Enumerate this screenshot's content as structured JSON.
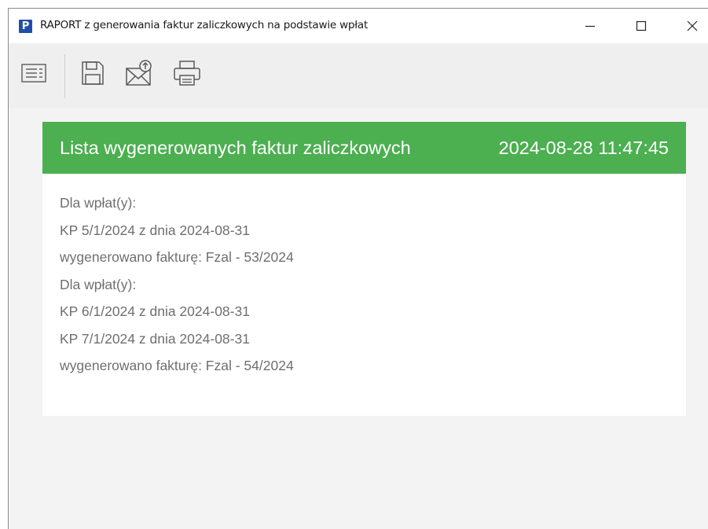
{
  "window": {
    "app_icon_letter": "P",
    "title": "RAPORT z generowania faktur zaliczkowych na podstawie wpłat",
    "controls": {
      "minimize": "minimize-icon",
      "maximize": "maximize-icon",
      "close": "close-icon"
    }
  },
  "toolbar": {
    "buttons": [
      {
        "icon": "list-icon"
      },
      {
        "icon": "save-icon"
      },
      {
        "icon": "send-mail-icon"
      },
      {
        "icon": "print-icon"
      }
    ]
  },
  "report": {
    "header_title": "Lista wygenerowanych faktur zaliczkowych",
    "header_datetime": "2024-08-28 11:47:45",
    "header_color": "#4caf50",
    "lines": [
      "Dla wpłat(y):",
      "KP 5/1/2024 z dnia 2024-08-31",
      "wygenerowano fakturę: Fzal - 53/2024",
      "Dla wpłat(y):",
      "KP 6/1/2024 z dnia 2024-08-31",
      "KP 7/1/2024 z dnia 2024-08-31",
      "wygenerowano fakturę: Fzal - 54/2024"
    ]
  }
}
